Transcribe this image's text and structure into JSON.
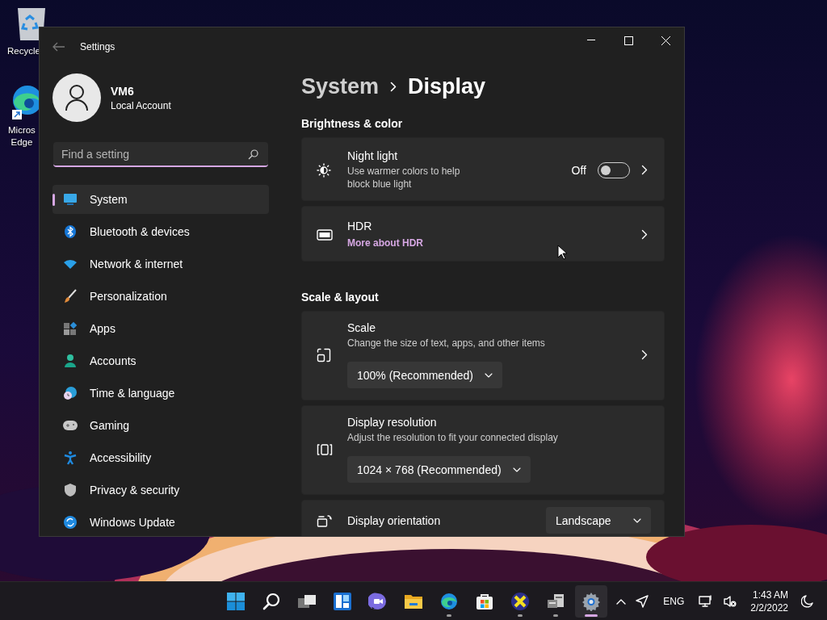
{
  "desktop": {
    "icons": [
      {
        "lines": [
          "Recycle"
        ]
      },
      {
        "lines": [
          "Micros",
          "Edge"
        ]
      }
    ]
  },
  "window": {
    "title": "Settings"
  },
  "account": {
    "name": "VM6",
    "type": "Local Account"
  },
  "search": {
    "placeholder": "Find a setting"
  },
  "nav": [
    {
      "label": "System",
      "selected": true
    },
    {
      "label": "Bluetooth & devices",
      "selected": false
    },
    {
      "label": "Network & internet",
      "selected": false
    },
    {
      "label": "Personalization",
      "selected": false
    },
    {
      "label": "Apps",
      "selected": false
    },
    {
      "label": "Accounts",
      "selected": false
    },
    {
      "label": "Time & language",
      "selected": false
    },
    {
      "label": "Gaming",
      "selected": false
    },
    {
      "label": "Accessibility",
      "selected": false
    },
    {
      "label": "Privacy & security",
      "selected": false
    },
    {
      "label": "Windows Update",
      "selected": false
    }
  ],
  "breadcrumb": [
    "System",
    "Display"
  ],
  "sections": [
    {
      "title": "Brightness & color",
      "cards": [
        {
          "kind": "toggle",
          "title": "Night light",
          "description": "Use warmer colors to help block blue light",
          "state_label": "Off",
          "on": false,
          "opens_page": true
        },
        {
          "kind": "link",
          "title": "HDR",
          "link": "More about HDR",
          "opens_page": true
        }
      ]
    },
    {
      "title": "Scale & layout",
      "cards": [
        {
          "kind": "dropdown",
          "title": "Scale",
          "description": "Change the size of text, apps, and other items",
          "value": "100% (Recommended)",
          "opens_page": true
        },
        {
          "kind": "dropdown",
          "title": "Display resolution",
          "description": "Adjust the resolution to fit your connected display",
          "value": "1024 × 768 (Recommended)",
          "opens_page": false
        },
        {
          "kind": "inline",
          "title": "Display orientation",
          "value": "Landscape",
          "opens_page": false
        }
      ]
    }
  ],
  "taskbar": {
    "apps": [
      {
        "running": false,
        "selected": false
      },
      {
        "running": false,
        "selected": false
      },
      {
        "running": false,
        "selected": false
      },
      {
        "running": false,
        "selected": false
      },
      {
        "running": false,
        "selected": false
      },
      {
        "running": false,
        "selected": false
      },
      {
        "running": true,
        "selected": false
      },
      {
        "running": false,
        "selected": false
      },
      {
        "running": true,
        "selected": false
      },
      {
        "running": true,
        "selected": false
      },
      {
        "running": true,
        "selected": true
      }
    ],
    "language": "ENG",
    "time": "1:43 AM",
    "date": "2/2/2022"
  }
}
